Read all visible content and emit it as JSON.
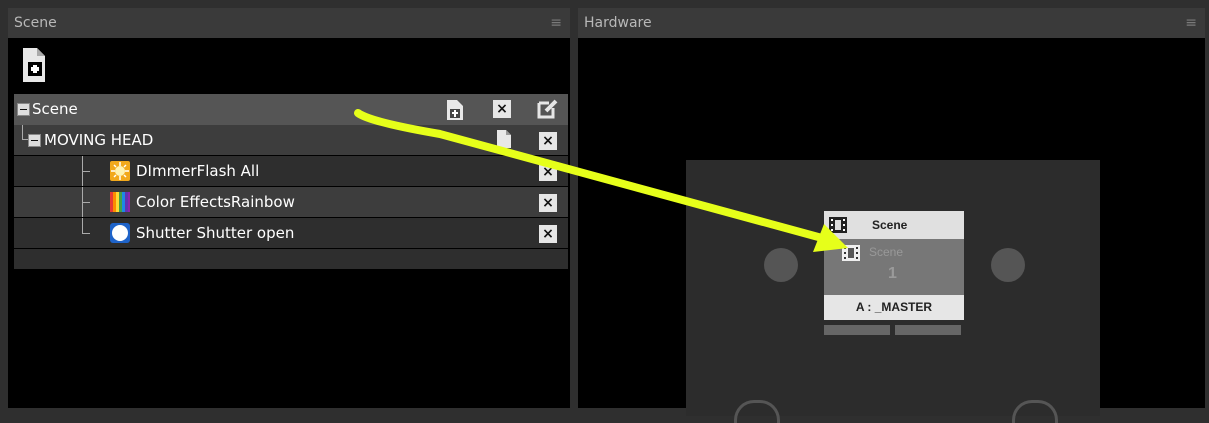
{
  "scene_panel": {
    "title": "Scene",
    "menu_icon": "hamburger-icon",
    "add_scene_icon": "add-file-icon",
    "tree": {
      "root": {
        "label": "Scene",
        "actions": [
          "add-file-icon",
          "close-icon",
          "edit-icon"
        ]
      },
      "group": {
        "label": "MOVING HEAD",
        "actions": [
          "file-icon",
          "close-icon"
        ]
      },
      "effects": [
        {
          "label": "DImmerFlash All",
          "icon": "dimmer-flash-icon"
        },
        {
          "label": "Color EffectsRainbow",
          "icon": "rainbow-icon"
        },
        {
          "label": "Shutter Shutter open",
          "icon": "shutter-icon"
        }
      ]
    }
  },
  "hardware_panel": {
    "title": "Hardware",
    "menu_icon": "hamburger-icon",
    "card": {
      "header": "Scene",
      "ghost_label": "Scene",
      "ghost_number": "1",
      "footer": "A : _MASTER"
    }
  },
  "annotation": {
    "color": "#e6ff1a",
    "icon": "arrow-annotation"
  },
  "colors": {
    "panel_bg": "#000000",
    "header_bg": "#3a3a3a",
    "selected_row": "#555555"
  }
}
